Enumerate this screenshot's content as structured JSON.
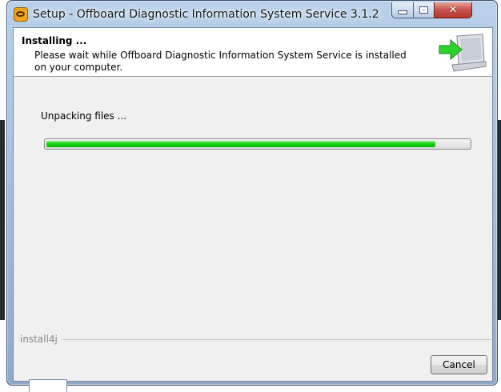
{
  "window": {
    "title": "Setup - Offboard Diagnostic Information System Service 3.1.2",
    "controls": [
      "minimize",
      "maximize",
      "close"
    ]
  },
  "header": {
    "title": "Installing ...",
    "description": "Please wait while Offboard Diagnostic Information System Service is installed on your computer.",
    "graphic_icon": "installer-computer-arrow-icon"
  },
  "main": {
    "status": "Unpacking files ...",
    "progress": 0.92
  },
  "footer": {
    "brand": "install4j",
    "cancel_label": "Cancel"
  },
  "colors": {
    "progress_fill": "#16d216",
    "titlebar": "#b9d1ea",
    "close_button": "#c75050"
  }
}
